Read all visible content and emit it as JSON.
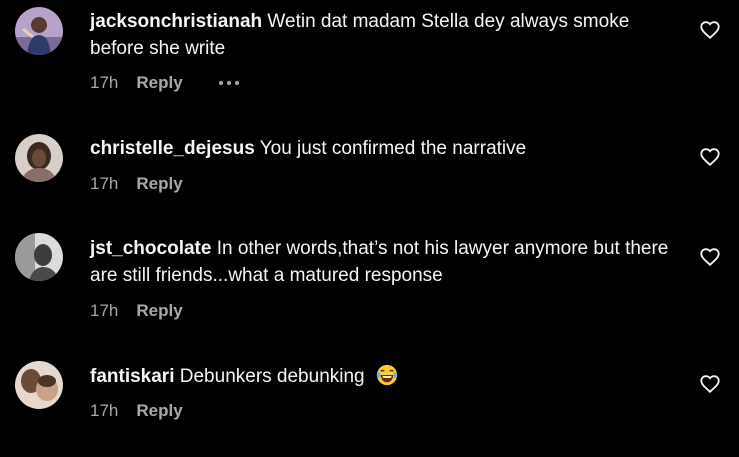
{
  "comments": [
    {
      "username": "jacksonchristianah",
      "text": "Wetin dat madam Stella dey always smoke before she write",
      "time": "17h",
      "reply": "Reply",
      "has_more": true,
      "avatar_color": "#b7a3c9"
    },
    {
      "username": "christelle_dejesus",
      "text": "You just confirmed the narrative",
      "time": "17h",
      "reply": "Reply",
      "has_more": false,
      "avatar_color": "#8a6f66"
    },
    {
      "username": "jst_chocolate",
      "text": "In other words,that’s not his lawyer anymore but there are still friends...what a matured response",
      "time": "17h",
      "reply": "Reply",
      "has_more": false,
      "avatar_color": "#c9c9c9"
    },
    {
      "username": "fantiskari",
      "text": "Debunkers debunking",
      "emoji": "laughing-tears-emoji",
      "time": "17h",
      "reply": "Reply",
      "has_more": false,
      "avatar_color": "#c8a189"
    }
  ],
  "icons": {
    "like": "heart-outline-icon",
    "more": "more-options-icon"
  },
  "colors": {
    "background": "#000000",
    "text": "#f5f5f5",
    "secondary": "#a8a8a8"
  }
}
